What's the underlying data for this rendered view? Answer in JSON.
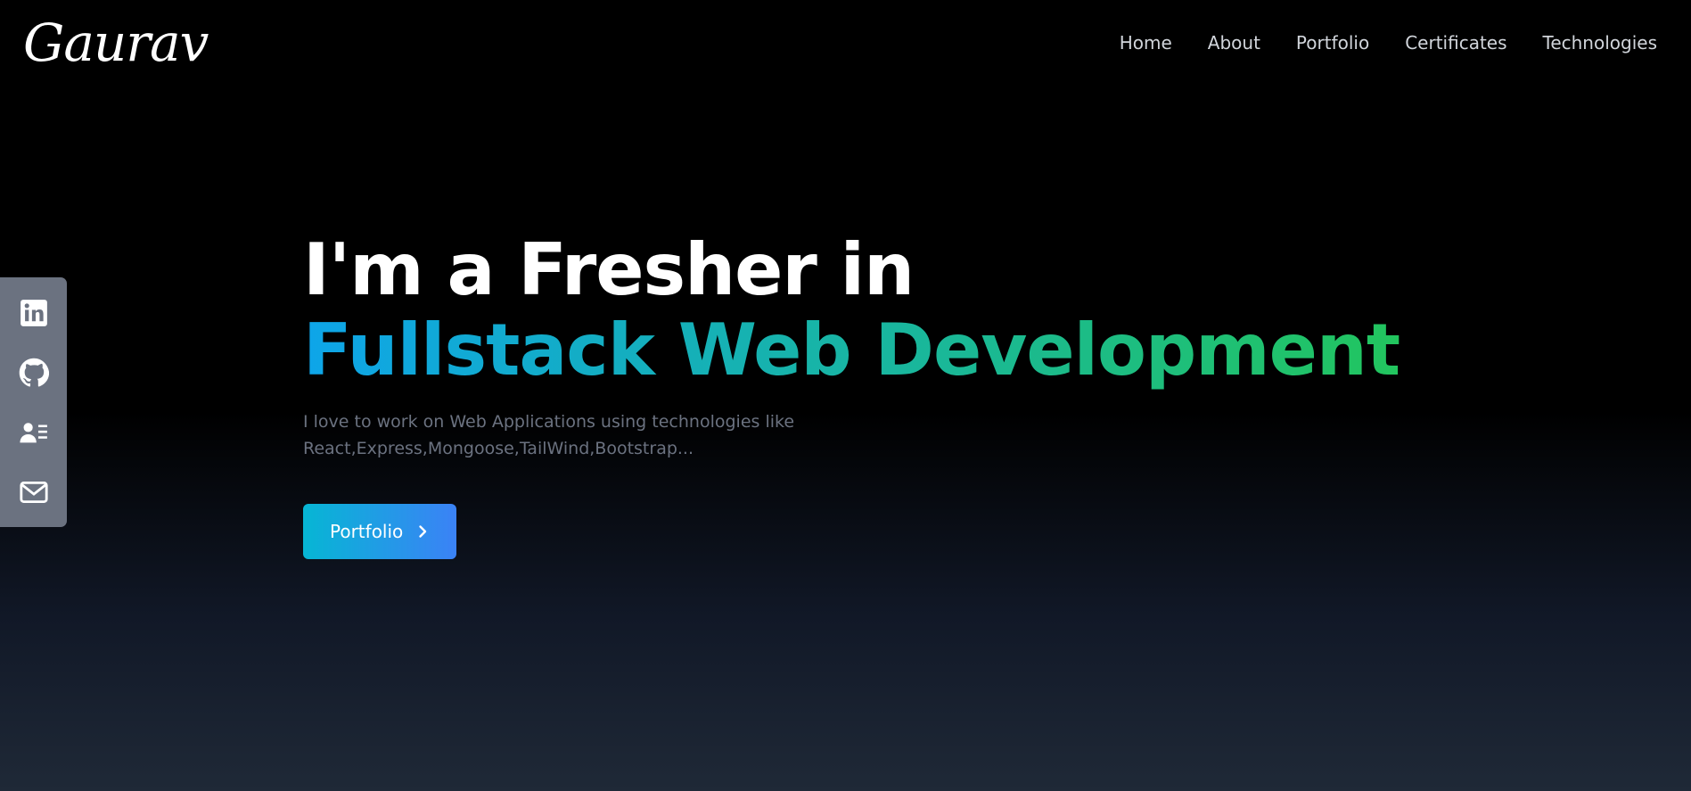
{
  "brand": {
    "logo_text": "Gaurav"
  },
  "nav": {
    "items": [
      {
        "label": "Home"
      },
      {
        "label": "About"
      },
      {
        "label": "Portfolio"
      },
      {
        "label": "Certificates"
      },
      {
        "label": "Technologies"
      }
    ]
  },
  "social": {
    "items": [
      {
        "icon": "linkedin-icon"
      },
      {
        "icon": "github-icon"
      },
      {
        "icon": "resume-icon"
      },
      {
        "icon": "mail-icon"
      }
    ],
    "background": "#6b7280"
  },
  "hero": {
    "line1": "I'm a Fresher in",
    "line2": "Fullstack Web Development",
    "description": "I love to work on Web Applications using technologies like React,Express,Mongoose,TailWind,Bootstrap...",
    "cta_label": "Portfolio",
    "cta_icon": "chevron-right-icon"
  },
  "colors": {
    "gradient_start": "#0ea5e9",
    "gradient_end": "#22c55e",
    "button_start": "#06b6d4",
    "button_end": "#3b82f6"
  }
}
